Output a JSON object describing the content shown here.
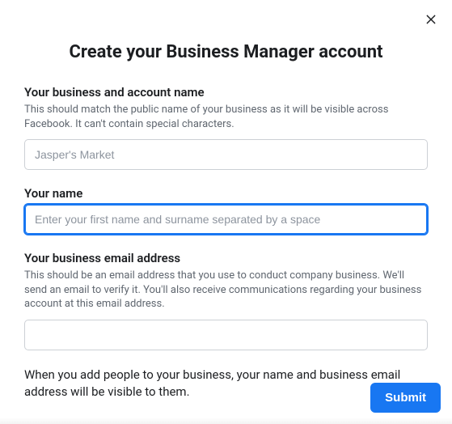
{
  "title": "Create your Business Manager account",
  "fields": {
    "business": {
      "label": "Your business and account name",
      "help": "This should match the public name of your business as it will be visible across Facebook. It can't contain special characters.",
      "placeholder": "Jasper's Market",
      "value": ""
    },
    "name": {
      "label": "Your name",
      "placeholder": "Enter your first name and surname separated by a space",
      "value": ""
    },
    "email": {
      "label": "Your business email address",
      "help": "This should be an email address that you use to conduct company business. We'll send an email to verify it. You'll also receive communications regarding your business account at this email address.",
      "placeholder": "",
      "value": ""
    }
  },
  "note": "When you add people to your business, your name and business email address will be visible to them.",
  "submit_label": "Submit"
}
